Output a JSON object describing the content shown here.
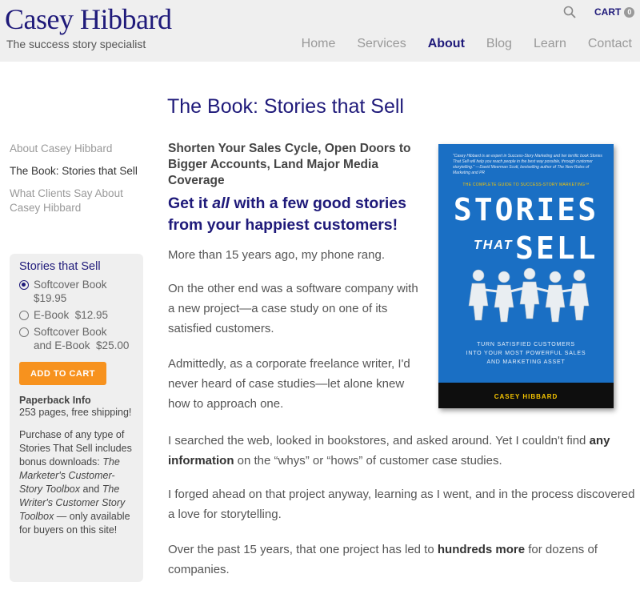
{
  "header": {
    "logo": "Casey Hibbard",
    "tagline": "The success story specialist",
    "cart_label": "CART",
    "cart_count": "0",
    "nav": [
      "Home",
      "Services",
      "About",
      "Blog",
      "Learn",
      "Contact"
    ],
    "active_nav": "About"
  },
  "page_title": "The Book: Stories that Sell",
  "sidebar": {
    "nav": [
      "About Casey Hibbard",
      "The Book: Stories that Sell",
      "What Clients Say About Casey Hibbard"
    ],
    "box_title": "Stories that Sell",
    "options": [
      {
        "label": "Softcover Book $19.95",
        "checked": true
      },
      {
        "label": "E-Book  $12.95",
        "checked": false
      },
      {
        "label": "Softcover Book and E-Book  $25.00",
        "checked": false
      }
    ],
    "option_lines": {
      "opt1_a": "Softcover Book",
      "opt1_b": "$19.95",
      "opt2": "E-Book  $12.95",
      "opt3_a": "Softcover Book",
      "opt3_b": "and E-Book  $25.00"
    },
    "add_button": "ADD TO CART",
    "paperback_title": "Paperback Info",
    "paperback_text": "253 pages, free shipping!",
    "purchase_1": "Purchase of any type of Stories That Sell includes bonus downloads: ",
    "purchase_t1": "The Marketer's Customer-Story Toolbox",
    "purchase_2": " and ",
    "purchase_t2": "The Writer's Customer Story Toolbox",
    "purchase_3": " — only available for buyers on this site!"
  },
  "main": {
    "subhead": "Shorten Your Sales Cycle, Open Doors to Bigger Accounts, Land Major Media Coverage",
    "headline_a": "Get it ",
    "headline_em": "all",
    "headline_b": " with a few good stories from your happiest customers!",
    "p1": "More than 15 years ago, my phone rang.",
    "p2": "On the other end was a software company with a new project—a case study on one of its satisfied customers.",
    "p3": "Admittedly, as a corporate freelance writer, I'd never heard of case studies—let alone knew how to approach one.",
    "p4_a": "I searched the web, looked in bookstores, and asked around. Yet I couldn't find ",
    "p4_b": "any information",
    "p4_c": " on the “whys” or “hows” of customer case studies.",
    "p5": "I forged ahead on that project anyway, learning as I went, and in the process discovered a love for storytelling.",
    "p6_a": "Over the past 15 years, that one project has led to ",
    "p6_b": "hundreds more",
    "p6_c": " for dozens of companies."
  },
  "cover": {
    "quote": "\"Casey Hibbard is an expert in Success-Story Marketing and her terrific book Stories That Sell will help you reach people in the best way possible, through customer storytelling.\" —David Meerman Scott, bestselling author of The New Rules of Marketing and PR",
    "guide": "THE COMPLETE GUIDE TO SUCCESS-STORY MARKETING™",
    "stories": "STORIES",
    "that": "THAT",
    "sell": "SELL",
    "subtitle_1": "TURN SATISFIED CUSTOMERS",
    "subtitle_2": "INTO YOUR MOST POWERFUL SALES",
    "subtitle_3": "AND MARKETING ASSET",
    "author": "CASEY HIBBARD"
  },
  "colors": {
    "brand": "#1f1a7a",
    "button": "#f7921e",
    "cover_blue": "#1a6fc4",
    "cover_yellow": "#f5c400"
  }
}
